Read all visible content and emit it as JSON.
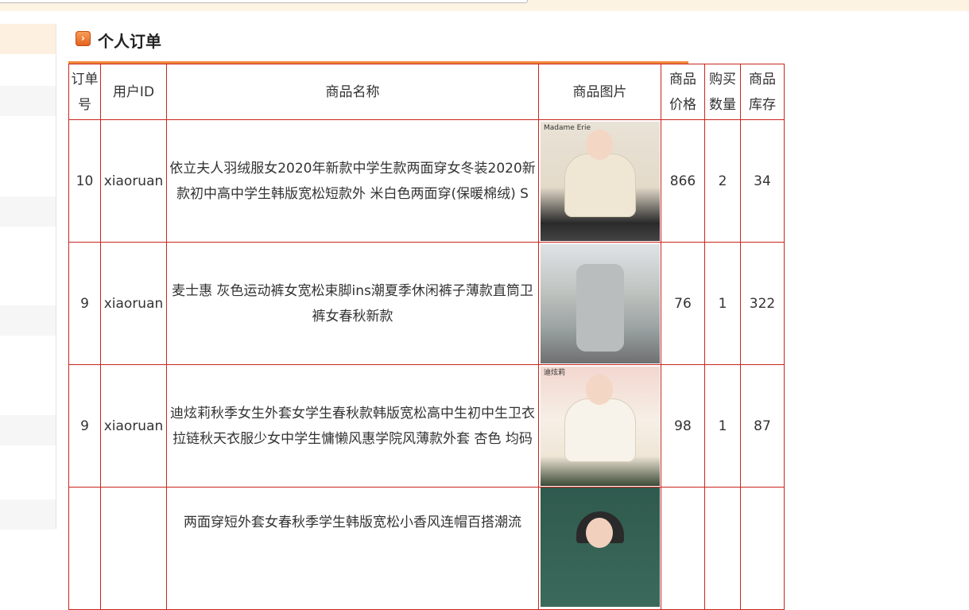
{
  "section": {
    "title": "个人订单",
    "icon": "orange-arrow-icon"
  },
  "table": {
    "headers": {
      "order_no": "订单号",
      "user_id": "用户ID",
      "product_name": "商品名称",
      "product_image": "商品图片",
      "price": "商品价格",
      "quantity": "购买数量",
      "stock": "商品库存"
    },
    "rows": [
      {
        "order_no": "10",
        "user_id": "xiaoruan",
        "product_name": "依立夫人羽绒服女2020年新款中学生款两面穿女冬装2020新款初中高中学生韩版宽松短款外 米白色两面穿(保暖棉绒) S",
        "image_caption": "Madame Erie",
        "price": "866",
        "quantity": "2",
        "stock": "34"
      },
      {
        "order_no": "9",
        "user_id": "xiaoruan",
        "product_name": "麦士惠 灰色运动裤女宽松束脚ins潮夏季休闲裤子薄款直筒卫裤女春秋新款",
        "image_caption": "",
        "price": "76",
        "quantity": "1",
        "stock": "322"
      },
      {
        "order_no": "9",
        "user_id": "xiaoruan",
        "product_name": "迪炫莉秋季女生外套女学生春秋款韩版宽松高中生初中生卫衣拉链秋天衣服少女中学生慵懒风惠学院风薄款外套 杏色 均码",
        "image_caption": "迪炫莉",
        "price": "98",
        "quantity": "1",
        "stock": "87"
      },
      {
        "order_no": "",
        "user_id": "",
        "product_name": "两面穿短外套女春秋季学生韩版宽松小香风连帽百搭潮流",
        "image_caption": "",
        "price": "",
        "quantity": "",
        "stock": ""
      }
    ]
  }
}
